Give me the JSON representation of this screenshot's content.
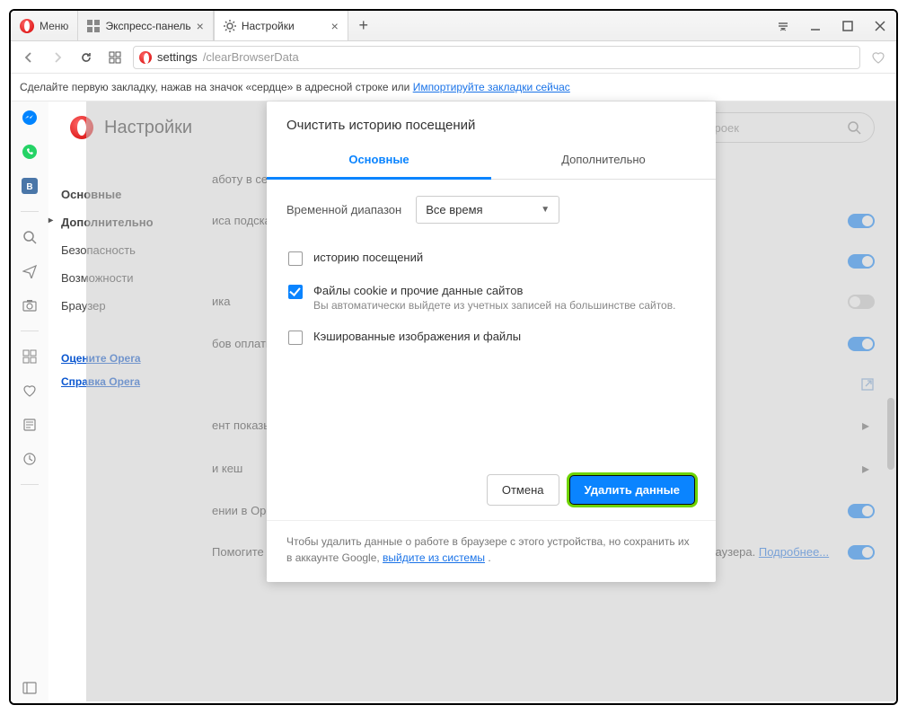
{
  "titlebar": {
    "menu_label": "Меню",
    "tabs": [
      {
        "label": "Экспресс-панель",
        "icon": "speed-dial-icon"
      },
      {
        "label": "Настройки",
        "icon": "gear-icon"
      }
    ],
    "new_tab": "+"
  },
  "address": {
    "proto": "settings",
    "path": "/clearBrowserData"
  },
  "bookmark_hint": {
    "text": "Сделайте первую закладку, нажав на значок «сердце» в адресной строке или ",
    "link": "Импортируйте закладки сейчас"
  },
  "sidebar_icons": [
    "messenger-icon",
    "whatsapp-icon",
    "vk-icon",
    "search-icon",
    "send-icon",
    "camera-icon",
    "grid-icon",
    "heart-icon",
    "news-icon",
    "clock-icon",
    "panel-icon"
  ],
  "page": {
    "title": "Настройки",
    "search_placeholder": "Поиск настроек"
  },
  "nav": {
    "items": [
      {
        "label": "Основные",
        "bold": true
      },
      {
        "label": "Дополнительно",
        "bold": true,
        "expand": true
      },
      {
        "label": "Безопасность"
      },
      {
        "label": "Возможности"
      },
      {
        "label": "Браузер"
      }
    ],
    "links": [
      {
        "label": "Оцените Opera"
      },
      {
        "label": "Справка Opera"
      }
    ]
  },
  "settings_partials": [
    {
      "text": "аботу в сети еще лючить",
      "toggle": "none"
    },
    {
      "text": "иса подсказок в",
      "toggle": "on"
    },
    {
      "text": "",
      "toggle": "on"
    },
    {
      "text": "ика",
      "toggle": "off"
    },
    {
      "text": "бов оплаты",
      "toggle": "on"
    },
    {
      "text": "",
      "toggle": "open"
    },
    {
      "text": "ент показывать на",
      "toggle": "arrow"
    },
    {
      "text": "и кеш",
      "toggle": "arrow"
    },
    {
      "text": "ении в Opera",
      "toggle": "on"
    }
  ],
  "settings_footer": {
    "text": "Помогите усовершенствовать Opera, отправляя информацию об использовании функций браузера. ",
    "link": "Подробнее...",
    "toggle": "on"
  },
  "modal": {
    "title": "Очистить историю посещений",
    "tabs": {
      "basic": "Основные",
      "advanced": "Дополнительно"
    },
    "range_label": "Временной диапазон",
    "range_value": "Все время",
    "options": [
      {
        "label": "историю посещений",
        "checked": false
      },
      {
        "label": "Файлы cookie и прочие данные сайтов",
        "sub": "Вы автоматически выйдете из учетных записей на большинстве сайтов.",
        "checked": true
      },
      {
        "label": "Кэшированные изображения и файлы",
        "checked": false
      }
    ],
    "cancel": "Отмена",
    "confirm": "Удалить данные",
    "footer_text": "Чтобы удалить данные о работе в браузере с этого устройства, но сохранить их в аккаунте Google, ",
    "footer_link": "выйдите из системы",
    "footer_dot": " ."
  }
}
